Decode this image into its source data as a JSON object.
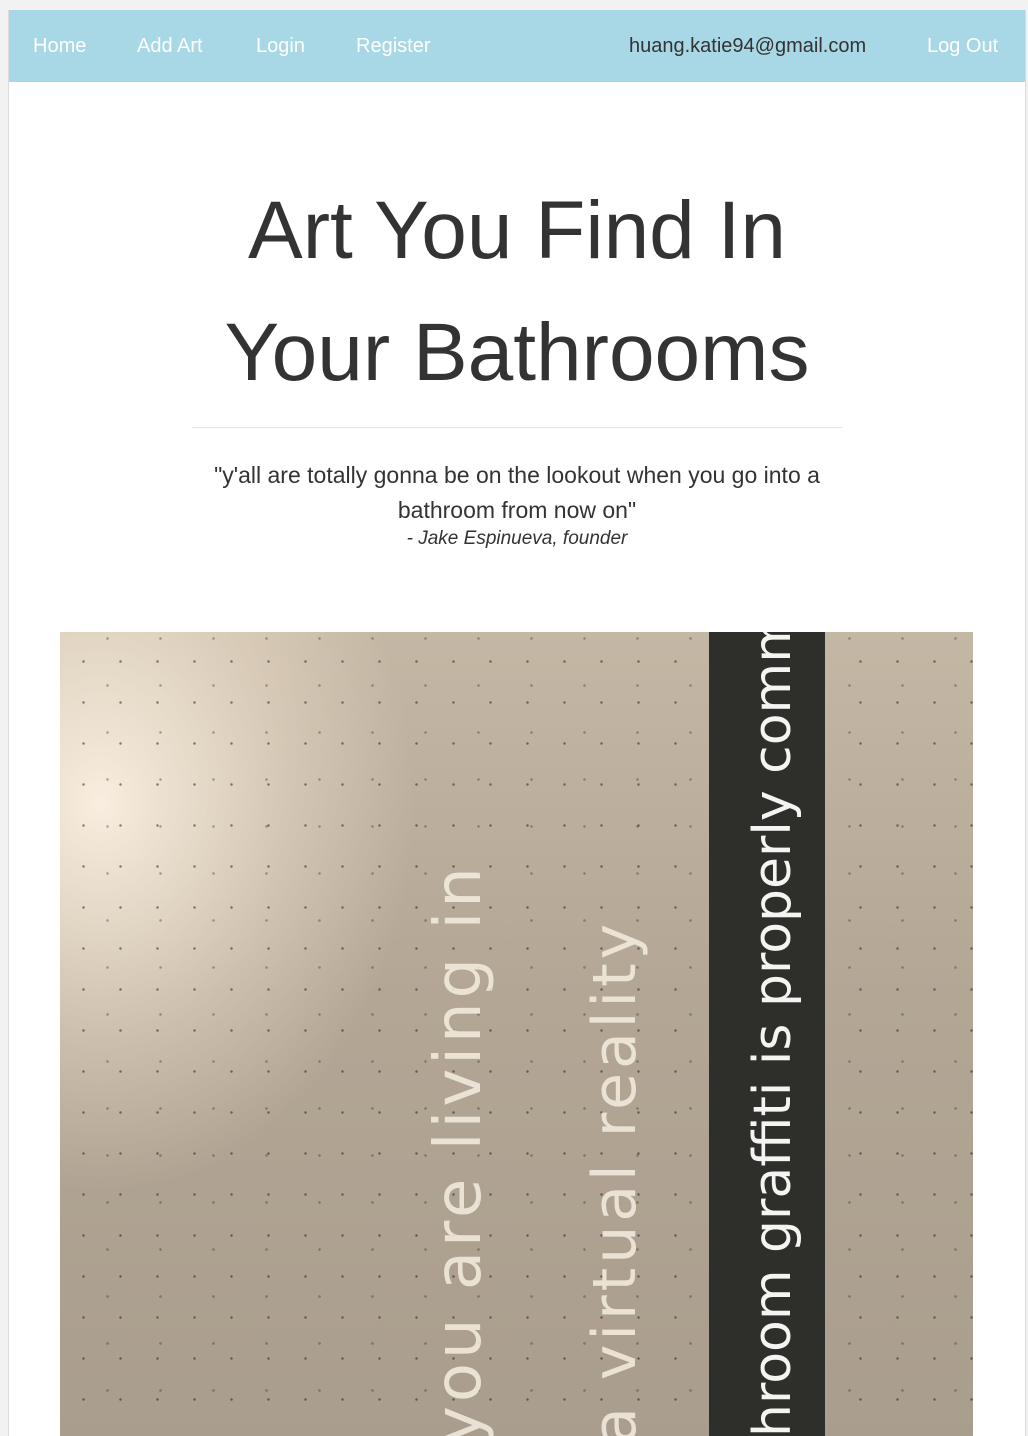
{
  "nav": {
    "home": "Home",
    "add_art": "Add Art",
    "login": "Login",
    "register": "Register",
    "user_email": "huang.katie94@gmail.com",
    "logout": "Log Out"
  },
  "hero": {
    "title_line1": "Art You Find In",
    "title_line2": "Your Bathrooms",
    "quote_line1": "\"y'all are totally gonna be on the lookout when you go into a",
    "quote_line2": "bathroom from now on\"",
    "attribution": "- Jake Espinueva, founder"
  },
  "photo": {
    "graffiti_line1": "you are living in",
    "graffiti_line2": "a virtual reality",
    "caption": "hroom graffiti is properly commen"
  },
  "colors": {
    "navbar": "#a8d7e5",
    "nav_text": "#ffffff",
    "heading_text": "#333333"
  }
}
